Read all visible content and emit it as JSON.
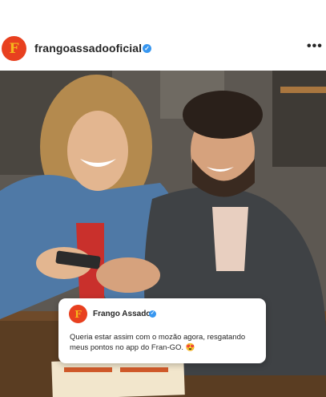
{
  "post_header": {
    "username": "frangoassadooficial",
    "avatar_letter": "F",
    "verified_icon": "verified-badge-icon",
    "more_label": "•••"
  },
  "quote_card": {
    "avatar_letter": "F",
    "name": "Frango Assado",
    "text": "Queria estar assim com o mozão agora, resgatando meus pontos no app do Fran-GO. 😍"
  },
  "colors": {
    "brand_red": "#e8401f",
    "brand_yellow": "#f5b61c",
    "verified_blue": "#3897f0"
  }
}
